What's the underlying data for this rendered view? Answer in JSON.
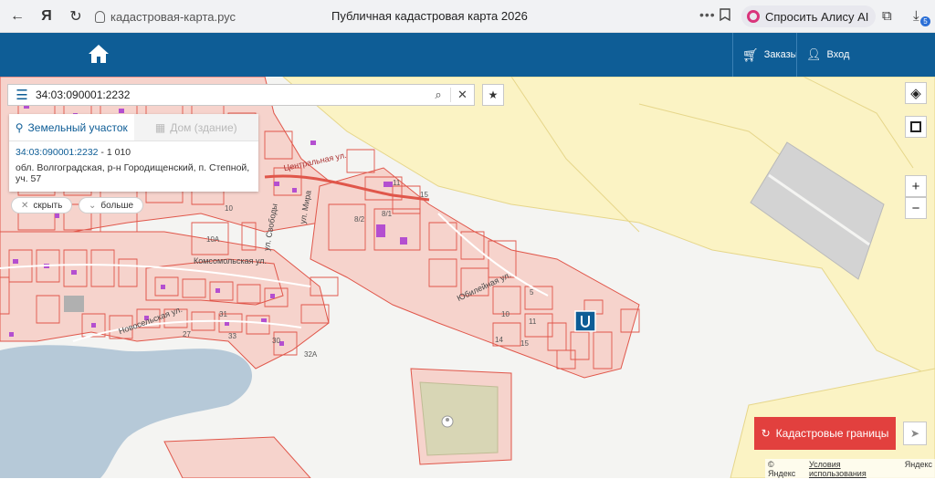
{
  "browser": {
    "url": "кадастровая-карта.рус",
    "title": "Публичная кадастровая карта 2026",
    "alice_label": "Спросить Алису AI",
    "downloads_count": "5"
  },
  "header": {
    "orders_label": "Заказы",
    "login_label": "Вход"
  },
  "search": {
    "value": "34:03:090001:2232"
  },
  "panel": {
    "tab_land": "Земельный участок",
    "tab_house": "Дом (здание)",
    "cad_number": "34:03:090001:2232",
    "area": " - 1 010",
    "address": "обл. Волгоградская, р-н Городищенский, п. Степной, уч. 57",
    "hide_label": "скрыть",
    "more_label": "больше"
  },
  "map": {
    "streets": {
      "komsomolskaya": "Комсомольская ул.",
      "novoselskaya": "Новосельская ул.",
      "yubileynaya": "Юбилейная ул.",
      "mira": "ул. Мира",
      "svobody": "ул. Свободы",
      "tsentralnaya": "Центральная ул."
    },
    "numbers": [
      "10",
      "10А",
      "11",
      "15",
      "8/2",
      "8/1",
      "5",
      "10",
      "11",
      "14",
      "15",
      "32А",
      "30",
      "27",
      "33",
      "31"
    ]
  },
  "controls": {
    "zoom_in": "+",
    "zoom_out": "−",
    "cadastral_button": "Кадастровые границы"
  },
  "attribution": {
    "yandex": "© Яндекс",
    "terms": "Условия использования",
    "logo": "Яндекс"
  },
  "colors": {
    "header": "#0e5d96",
    "parcel_stroke": "#e0564a",
    "parcel_fill": "#f6d3cc",
    "zone_yellow": "#fbf3c4",
    "cad_button": "#e2403e"
  }
}
